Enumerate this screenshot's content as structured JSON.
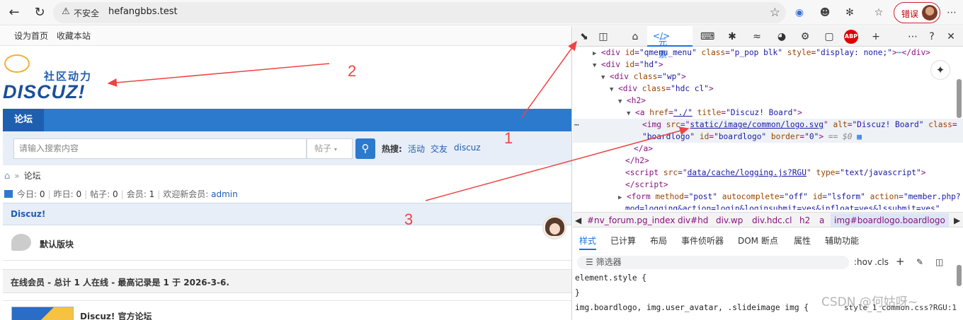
{
  "browser": {
    "unsafe_label": "不安全",
    "url": "hefangbbs.test",
    "error_label": "错误"
  },
  "site": {
    "toplinks": [
      "设为首页",
      "收藏本站"
    ],
    "logo_cn": "社区动力",
    "logo_word": "DISCUZ!",
    "nav_item": "论坛",
    "search_placeholder": "请输入搜索内容",
    "search_type": "帖子",
    "hot_label": "热搜:",
    "hot_links": [
      "活动",
      "交友",
      "discuz"
    ],
    "breadcrumb": "论坛",
    "stats": {
      "today_label": "今日:",
      "today": "0",
      "yesterday_label": "昨日:",
      "yesterday": "0",
      "posts_label": "帖子:",
      "posts": "0",
      "members_label": "会员:",
      "members": "1",
      "welcome_label": "欢迎新会员:",
      "newest": "admin"
    },
    "category": "Discuz!",
    "forum_name": "默认版块",
    "online": "在线会员 - 总计 1 人在线 - 最高记录是 1 于 2026-3-6.",
    "link_name": "Discuz! 官方论坛"
  },
  "annotations": [
    "1",
    "2",
    "3"
  ],
  "devtools": {
    "active_tab": "元素",
    "dom": {
      "l1_attr1": "id",
      "l1_val1": "\"qmenu_menu\"",
      "l1_attr2": "class",
      "l1_val2": "\"p_pop blk\"",
      "l1_attr3": "style",
      "l1_val3": "\"display: none;\"",
      "l2_val": "\"hd\"",
      "l3_val": "\"wp\"",
      "l4_val": "\"hdc cl\"",
      "l6_href": "\"./\"",
      "l6_title": "\"Discuz! Board\"",
      "l7_src": "static/image/common/logo.svg",
      "l7_alt": "\"Discuz! Board\"",
      "l8_class": "\"boardlogo\"",
      "l8_id": "\"boardlogo\"",
      "l8_border": "\"0\"",
      "l8_eq": "== $0",
      "l11_src": "data/cache/logging.js?RGU",
      "l11_type": "\"text/javascript\"",
      "l13_action": "\"member.php?",
      "l14": "mod=logging&action=login&loginsubmit=yes&infloat=yes&lssubmit=yes\""
    },
    "crumbs": [
      "#nv_forum.pg_index",
      "div#hd",
      "div.wp",
      "div.hdc.cl",
      "h2",
      "a",
      "img#boardlogo.boardlogo"
    ],
    "subtabs": [
      "样式",
      "已计算",
      "布局",
      "事件侦听器",
      "DOM 断点",
      "属性",
      "辅助功能"
    ],
    "filter_placeholder": "筛选器",
    "hov": ":hov",
    "cls": ".cls",
    "css_l1": "element.style {",
    "css_l2": "}",
    "css_l3": "img.boardlogo, img.user_avatar, .slideimage img {",
    "css_link": "style_1_common.css?RGU:1"
  },
  "watermark": "CSDN @何姑呀~"
}
